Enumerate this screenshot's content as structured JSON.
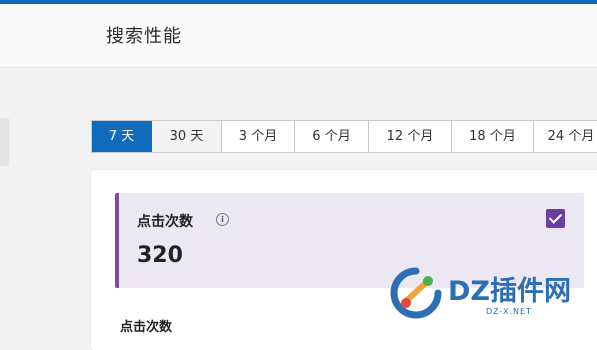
{
  "header": {
    "title": "搜索性能"
  },
  "tabs": [
    {
      "label": "7 天",
      "state": "selected"
    },
    {
      "label": "30 天",
      "state": "alt"
    },
    {
      "label": "3 个月",
      "state": ""
    },
    {
      "label": "6 个月",
      "state": ""
    },
    {
      "label": "12 个月",
      "state": ""
    },
    {
      "label": "18 个月",
      "state": ""
    },
    {
      "label": "24 个月",
      "state": ""
    }
  ],
  "metric": {
    "label": "点击次数",
    "value": "320",
    "info_icon": "info-icon",
    "checked": true
  },
  "section": {
    "label": "点击次数"
  },
  "watermark": {
    "text": "DZ插件网",
    "sub": "DZ-X.NET"
  },
  "colors": {
    "accent": "#0f6cbd",
    "metric_border": "#7a4ea0",
    "metric_bg": "#ece8f3",
    "checkbox": "#6b3fa0"
  }
}
